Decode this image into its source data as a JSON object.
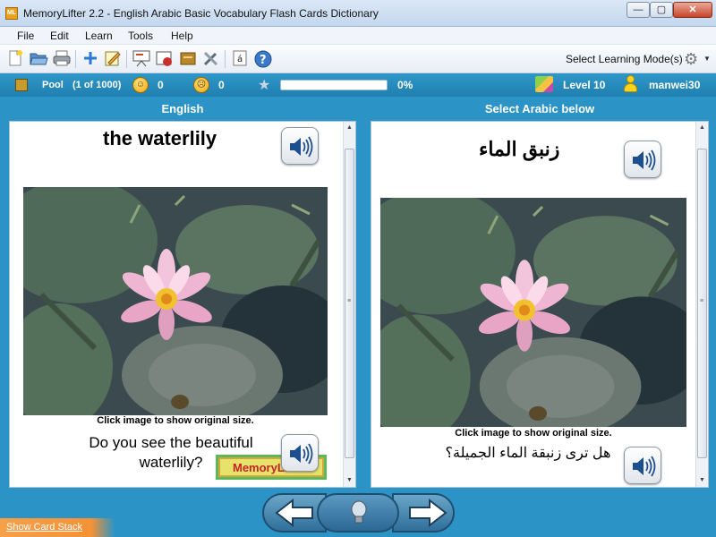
{
  "window": {
    "title": "MemoryLifter 2.2 - English Arabic Basic Vocabulary Flash Cards Dictionary",
    "app_icon_text": "ML",
    "min_glyph": "—",
    "max_glyph": "▢",
    "close_glyph": "✕"
  },
  "menu": [
    "File",
    "Edit",
    "Learn",
    "Tools",
    "Help"
  ],
  "toolbar": {
    "icons": [
      "new-file-icon",
      "open-folder-icon",
      "print-icon",
      "add-card-icon",
      "edit-card-icon",
      "presentation-icon",
      "statistics-icon",
      "card-box-icon",
      "tools-icon",
      "char-map-icon",
      "help-icon"
    ],
    "mode_label": "Select Learning Mode(s)"
  },
  "status": {
    "pool_label": "Pool",
    "pool_count": "(1 of 1000)",
    "smile_count": "0",
    "neutral_count": "0",
    "progress_text": "0%",
    "progress_value": 0,
    "level": "Level 10",
    "user": "manwei30"
  },
  "columns": {
    "left_header": "English",
    "right_header": "Select Arabic below"
  },
  "question": {
    "word": "the waterlily",
    "image_caption": "Click image to show original size.",
    "sentence": "Do you see the beautiful waterlily?",
    "logo_text": "MemoryLifter"
  },
  "answer": {
    "word": "زنبق الماء",
    "image_caption": "Click image to show original size.",
    "sentence": "هل ترى زنبقة الماء الجميلة؟"
  },
  "footer": {
    "show_card_stack": "Show Card Stack"
  },
  "colors": {
    "accent": "#2b93c6",
    "status_text": "#ffffff",
    "show_stack_bg": "#f39236"
  }
}
